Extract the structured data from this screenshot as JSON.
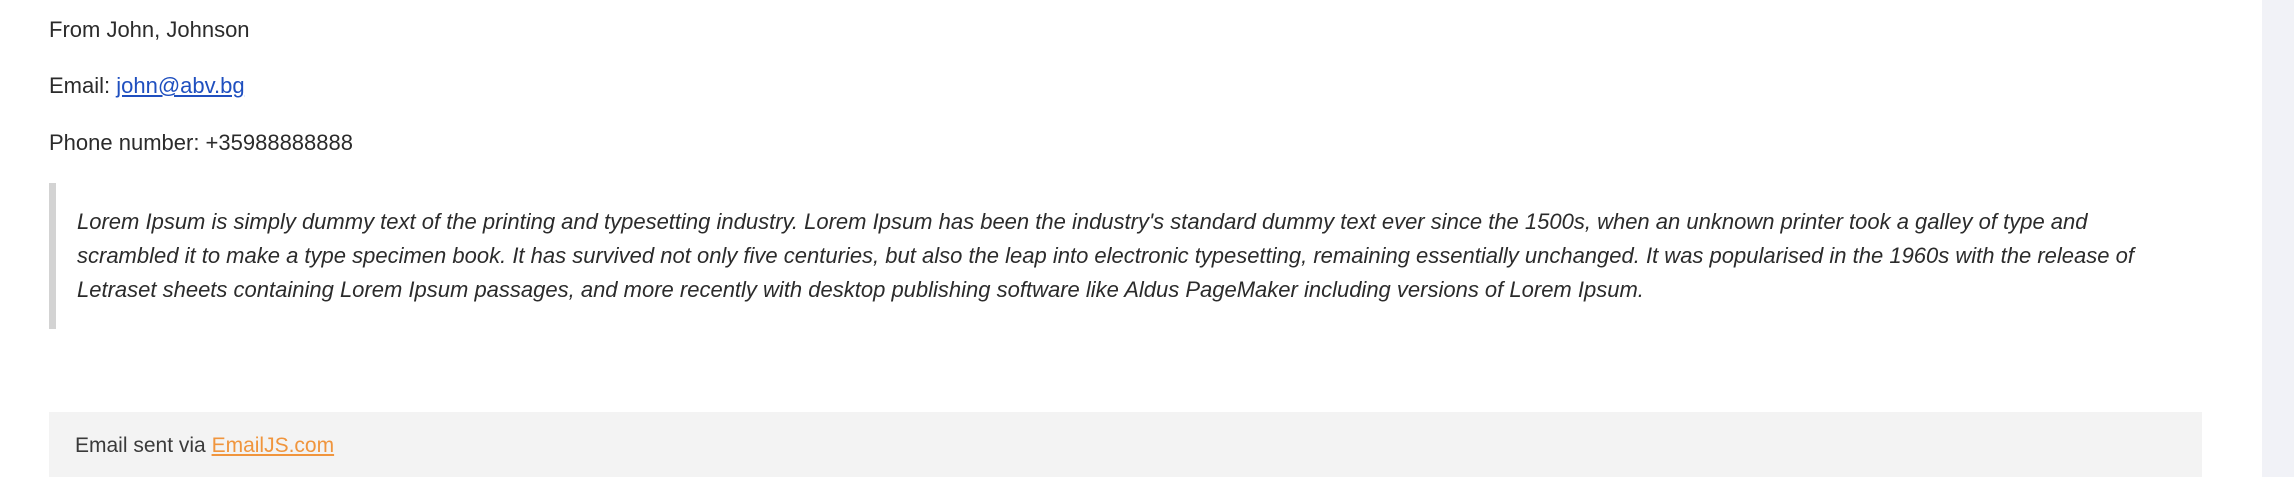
{
  "message": {
    "from_text": "From John, Johnson",
    "email_label": "Email: ",
    "email_value": "john@abv.bg",
    "phone_text": "Phone number: +35988888888",
    "quote_text": "Lorem Ipsum is simply dummy text of the printing and typesetting industry. Lorem Ipsum has been the industry's standard dummy text ever since the 1500s, when an unknown printer took a galley of type and scrambled it to make a type specimen book. It has survived not only five centuries, but also the leap into electronic typesetting, remaining essentially unchanged. It was popularised in the 1960s with the release of Letraset sheets containing Lorem Ipsum passages, and more recently with desktop publishing software like Aldus PageMaker including versions of Lorem Ipsum."
  },
  "footer": {
    "prefix": "Email sent via ",
    "link_text": "EmailJS.com"
  },
  "colors": {
    "link_blue": "#1f4fbf",
    "footer_link_orange": "#f0953d",
    "quote_border": "#d3d3d3",
    "footer_bg": "#f3f3f3"
  }
}
